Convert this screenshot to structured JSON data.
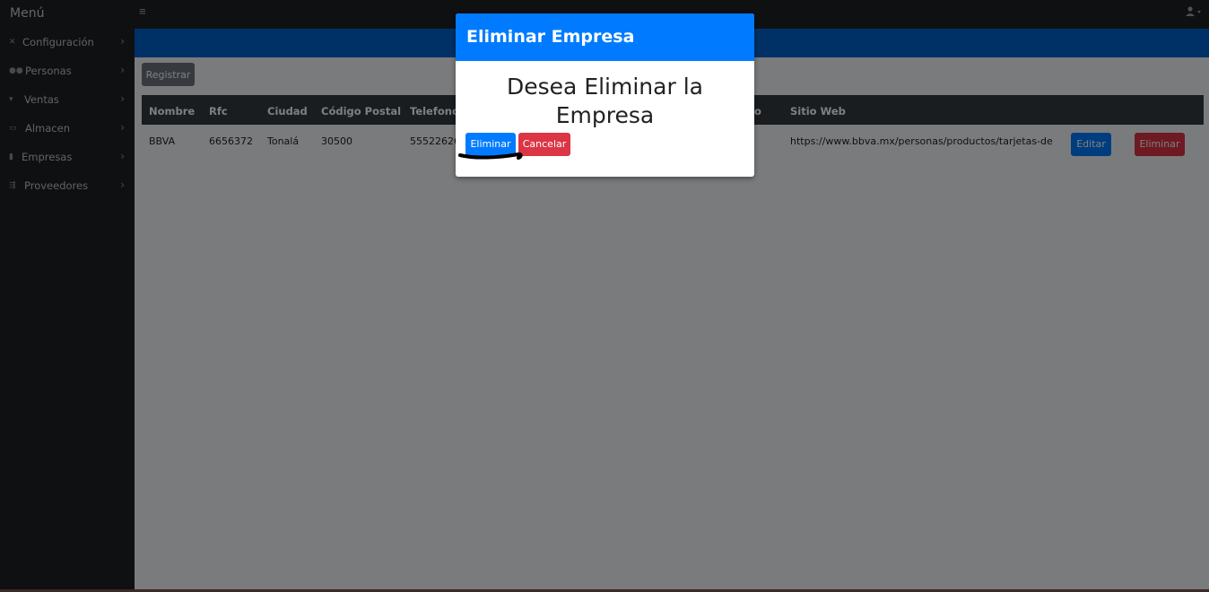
{
  "topbar": {
    "brand": "Menú",
    "hamburger": "≡",
    "user_icon": "user-icon"
  },
  "sidebar": {
    "items": [
      {
        "label": "Configuración",
        "icon": "tools-icon"
      },
      {
        "label": "Personas",
        "icon": "users-icon"
      },
      {
        "label": "Ventas",
        "icon": "cart-icon"
      },
      {
        "label": "Almacen",
        "icon": "warehouse-icon"
      },
      {
        "label": "Empresas",
        "icon": "building-icon"
      },
      {
        "label": "Proveedores",
        "icon": "truck-icon"
      }
    ]
  },
  "main": {
    "register_label": "Registrar",
    "table": {
      "headers": [
        "Nombre",
        "Rfc",
        "Ciudad",
        "Código Postal",
        "Telefono",
        "o",
        "Sitio Web"
      ],
      "row": {
        "nombre": "BBVA",
        "rfc": "6656372",
        "ciudad": "Tonalá",
        "cp": "30500",
        "telefono": "555226266",
        "sitio": "https://www.bbva.mx/personas/productos/tarjetas-de"
      },
      "edit_label": "Editar",
      "delete_label": "Eliminar"
    }
  },
  "modal": {
    "title": "Eliminar Empresa",
    "question": "Desea Eliminar la Empresa",
    "confirm_label": "Eliminar",
    "cancel_label": "Cancelar"
  },
  "colors": {
    "primary": "#007bff",
    "danger": "#dc3545",
    "dark": "#343a40",
    "sidebar": "#1f2124"
  }
}
